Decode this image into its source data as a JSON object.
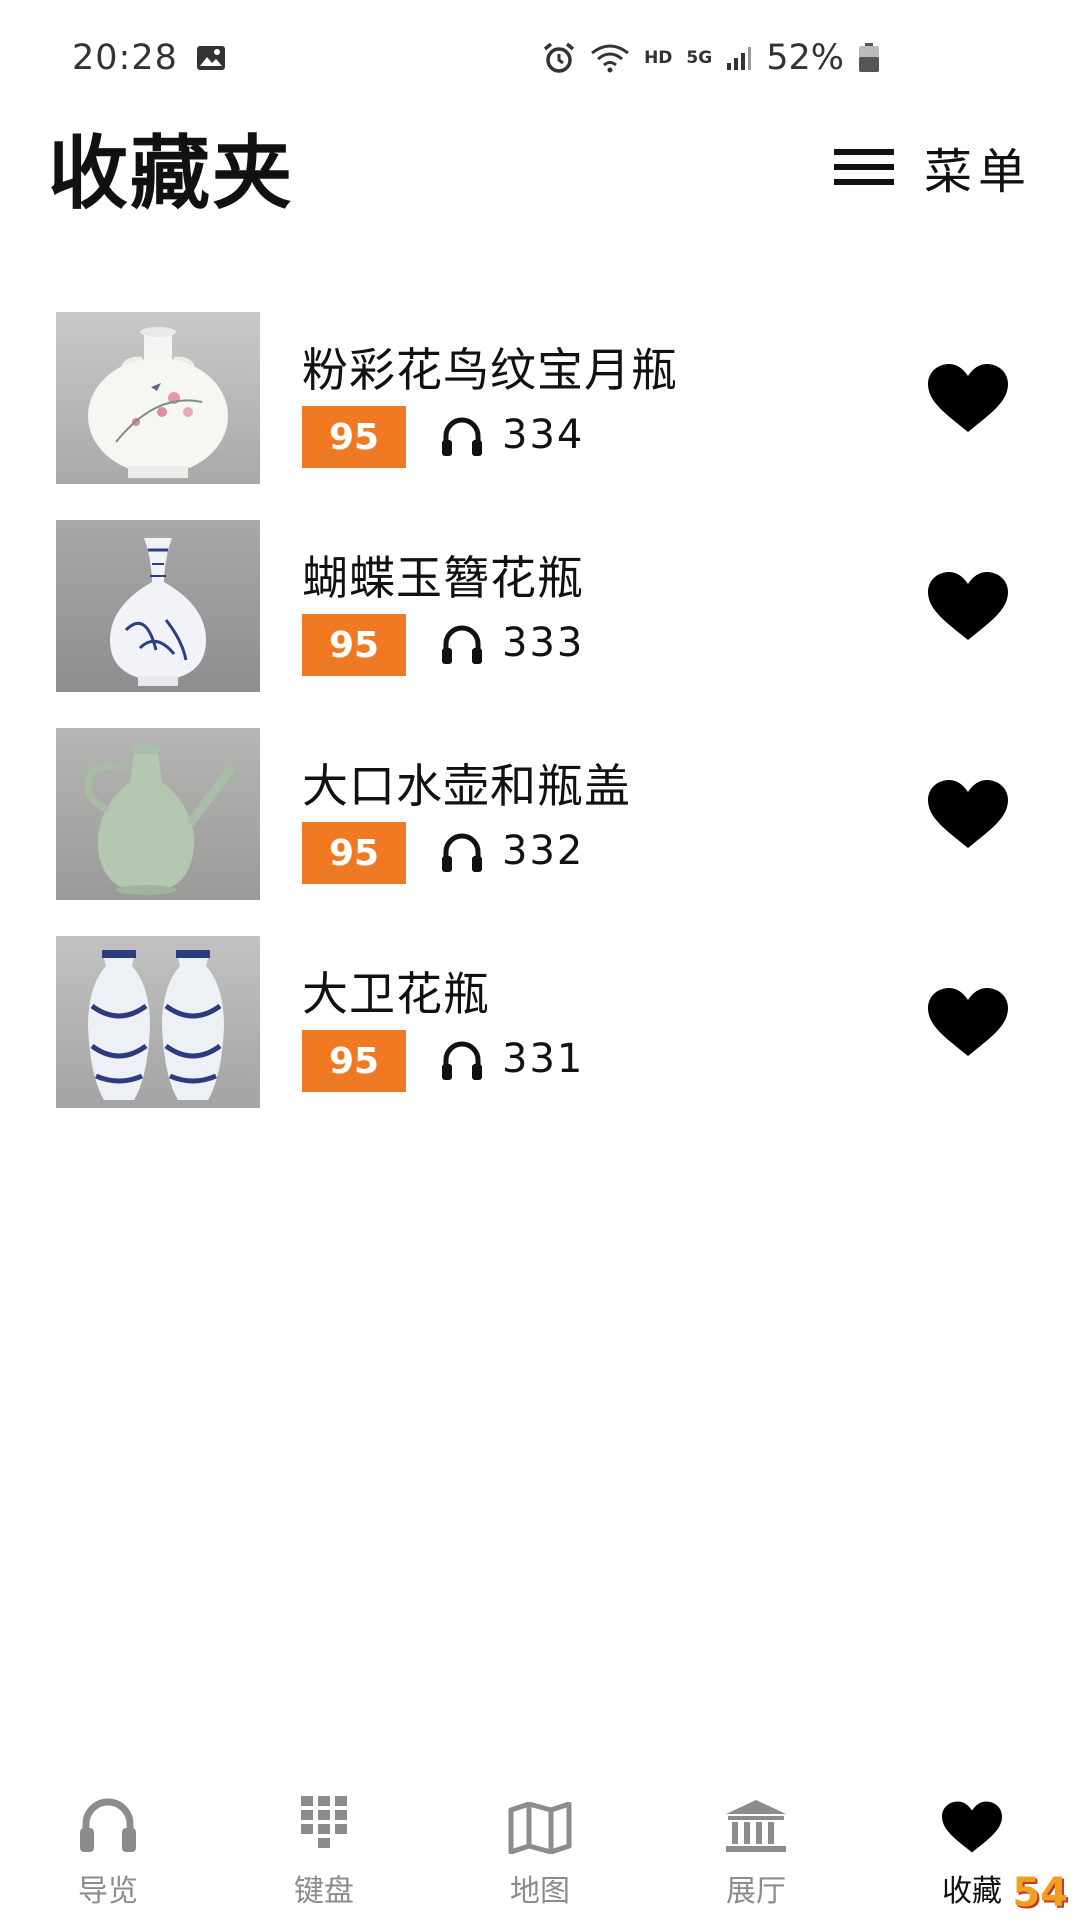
{
  "status_bar": {
    "time": "20:28",
    "hd_label": "HD",
    "network_label": "5G",
    "battery_percent": "52%",
    "icons": [
      "image-icon",
      "alarm-icon",
      "wifi-icon",
      "signal-icon",
      "battery-icon"
    ]
  },
  "header": {
    "title": "收藏夹",
    "menu_label": "菜单"
  },
  "favorites": [
    {
      "title": "粉彩花鸟纹宝月瓶",
      "score": "95",
      "listens": "334"
    },
    {
      "title": "蝴蝶玉簪花瓶",
      "score": "95",
      "listens": "333"
    },
    {
      "title": "大口水壶和瓶盖",
      "score": "95",
      "listens": "332"
    },
    {
      "title": "大卫花瓶",
      "score": "95",
      "listens": "331"
    }
  ],
  "bottom_nav": {
    "items": [
      {
        "label": "导览",
        "icon": "headphones-icon"
      },
      {
        "label": "键盘",
        "icon": "keypad-icon"
      },
      {
        "label": "地图",
        "icon": "map-icon"
      },
      {
        "label": "展厅",
        "icon": "museum-icon"
      },
      {
        "label": "收藏",
        "icon": "heart-icon"
      }
    ],
    "active_index": 4
  },
  "watermark": "54"
}
